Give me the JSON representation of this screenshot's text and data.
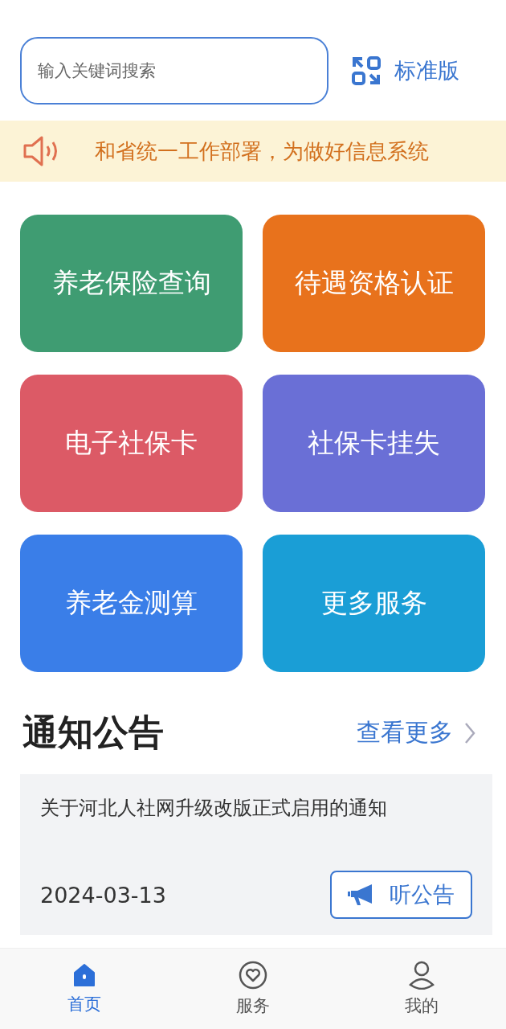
{
  "search": {
    "placeholder": "输入关键词搜索"
  },
  "version_switch": {
    "label": "标准版"
  },
  "marquee": {
    "text": "和省统一工作部署，为做好信息系统"
  },
  "services": [
    {
      "label": "养老保险查询",
      "color": "#3f9c72"
    },
    {
      "label": "待遇资格认证",
      "color": "#e8721c"
    },
    {
      "label": "电子社保卡",
      "color": "#dc5a66"
    },
    {
      "label": "社保卡挂失",
      "color": "#6a6fd6"
    },
    {
      "label": "养老金测算",
      "color": "#3a7ee8"
    },
    {
      "label": "更多服务",
      "color": "#1a9ed6"
    }
  ],
  "notices": {
    "title": "通知公告",
    "more": "查看更多",
    "items": [
      {
        "title": "关于河北人社网升级改版正式启用的通知",
        "date": "2024-03-13",
        "listen": "听公告"
      }
    ]
  },
  "tabs": [
    {
      "label": "首页",
      "kind": "home",
      "selected": true
    },
    {
      "label": "服务",
      "kind": "service",
      "selected": false
    },
    {
      "label": "我的",
      "kind": "profile",
      "selected": false
    }
  ]
}
